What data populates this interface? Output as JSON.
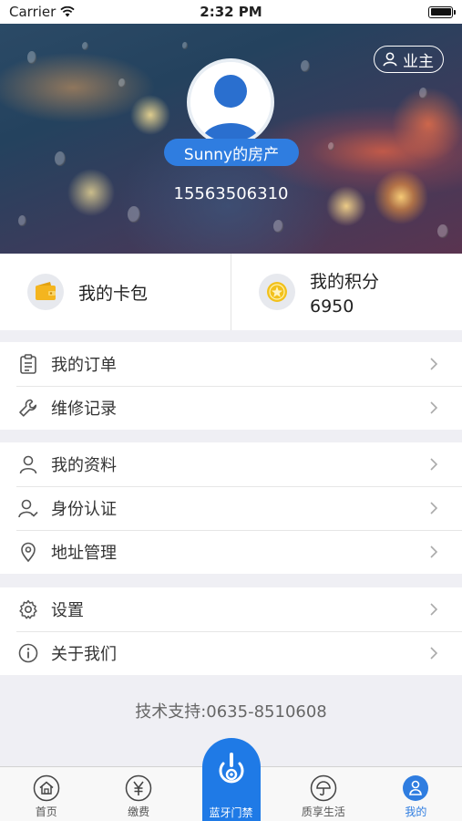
{
  "status_bar": {
    "carrier": "Carrier",
    "time": "2:32 PM"
  },
  "header": {
    "owner_badge": "业主",
    "property_name": "Sunny的房产",
    "phone": "15563506310"
  },
  "quick": {
    "wallet_label": "我的卡包",
    "points_label": "我的积分",
    "points_value": "6950"
  },
  "menu": {
    "group1": [
      {
        "label": "我的订单",
        "icon": "clipboard-icon"
      },
      {
        "label": "维修记录",
        "icon": "wrench-icon"
      }
    ],
    "group2": [
      {
        "label": "我的资料",
        "icon": "person-icon"
      },
      {
        "label": "身份认证",
        "icon": "person-check-icon"
      },
      {
        "label": "地址管理",
        "icon": "location-pin-icon"
      }
    ],
    "group3": [
      {
        "label": "设置",
        "icon": "gear-icon"
      },
      {
        "label": "关于我们",
        "icon": "info-icon"
      }
    ]
  },
  "support_text": "技术支持:0635-8510608",
  "tabbar": {
    "home": "首页",
    "pay": "缴费",
    "bluetooth": "蓝牙门禁",
    "life": "质享生活",
    "mine": "我的"
  },
  "colors": {
    "accent": "#2f7de0",
    "center_button": "#1f7ae6",
    "background": "#efeff4"
  }
}
